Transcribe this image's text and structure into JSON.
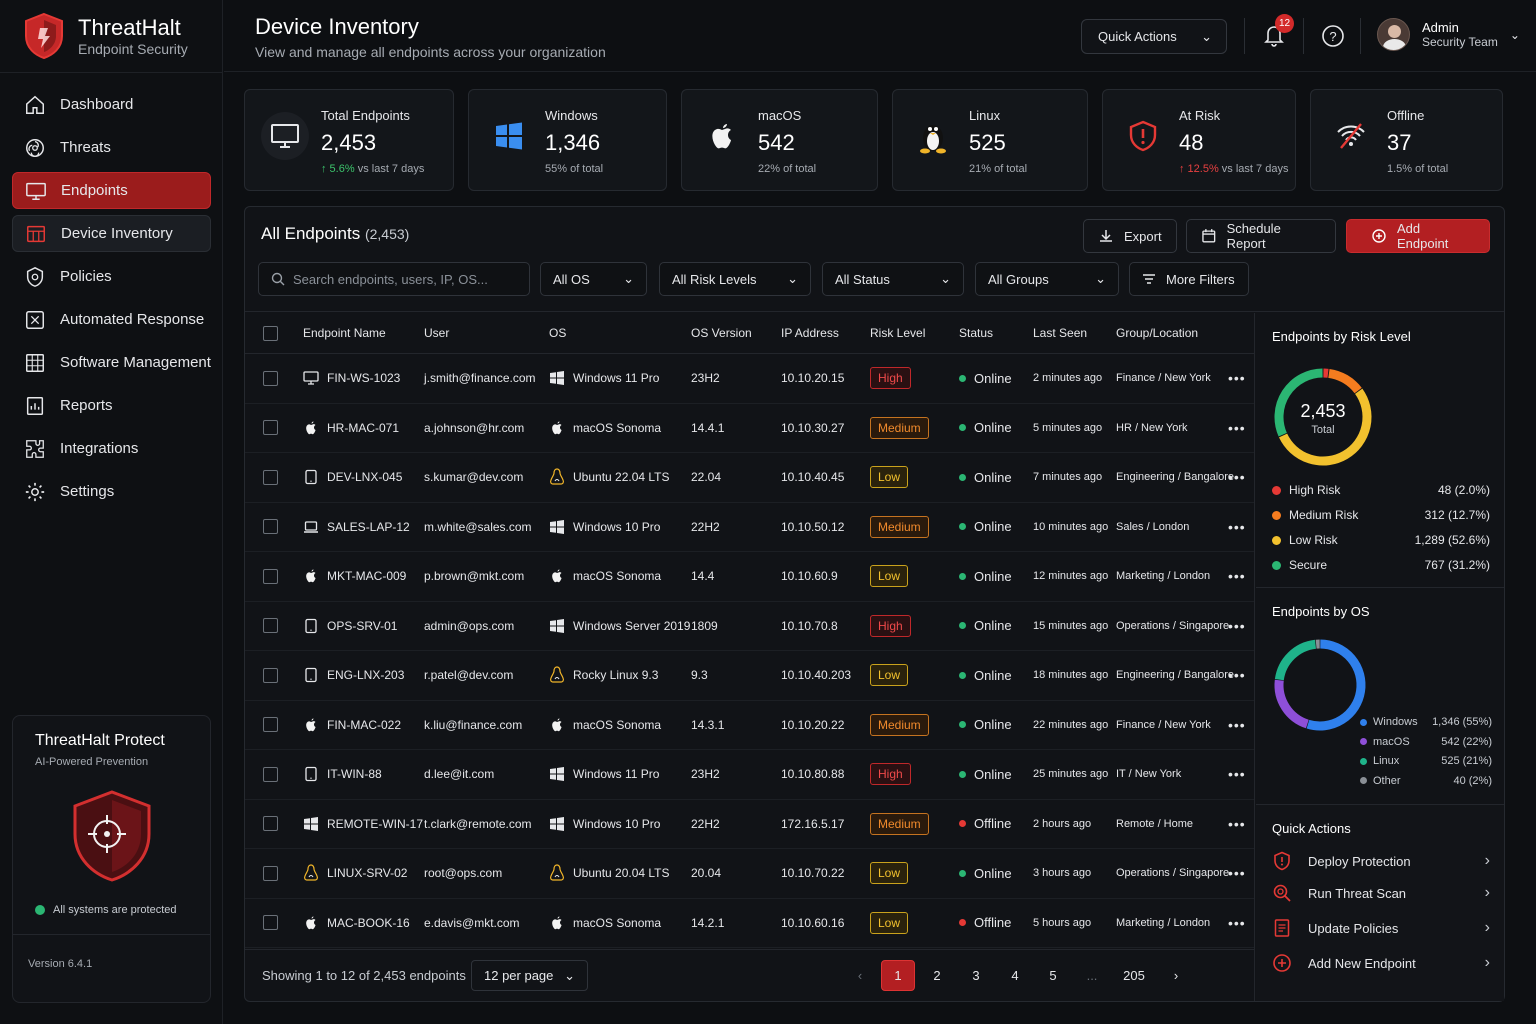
{
  "brand": {
    "name": "ThreatHalt",
    "tagline": "Endpoint Security"
  },
  "nav": [
    {
      "label": "Dashboard",
      "icon": "home-icon",
      "state": "normal"
    },
    {
      "label": "Threats",
      "icon": "biohazard-icon",
      "state": "normal"
    },
    {
      "label": "Endpoints",
      "icon": "monitor-icon",
      "state": "active"
    },
    {
      "label": "Device Inventory",
      "icon": "inventory-icon",
      "state": "sub"
    },
    {
      "label": "Policies",
      "icon": "policy-icon",
      "state": "normal"
    },
    {
      "label": "Automated Response",
      "icon": "automation-icon",
      "state": "normal"
    },
    {
      "label": "Software Management",
      "icon": "grid-icon",
      "state": "normal"
    },
    {
      "label": "Reports",
      "icon": "report-icon",
      "state": "normal"
    },
    {
      "label": "Integrations",
      "icon": "puzzle-icon",
      "state": "normal"
    },
    {
      "label": "Settings",
      "icon": "gear-icon",
      "state": "normal"
    }
  ],
  "promo": {
    "title": "ThreatHalt Protect",
    "subtitle": "AI-Powered Prevention",
    "status": "All systems are protected",
    "version": "Version 6.4.1"
  },
  "header": {
    "title": "Device Inventory",
    "subtitle": "View and manage all endpoints across your organization",
    "quick_actions": "Quick Actions",
    "notifications": "12",
    "user_name": "Admin",
    "user_role": "Security Team"
  },
  "stats": [
    {
      "label": "Total Endpoints",
      "value": "2,453",
      "trend": "↑ 5.6%",
      "note": " vs last 7 days",
      "icon": "monitor-icon",
      "trend_color": "green"
    },
    {
      "label": "Windows",
      "value": "1,346",
      "trend": "",
      "note": "55% of total",
      "icon": "windows-icon"
    },
    {
      "label": "macOS",
      "value": "542",
      "trend": "",
      "note": "22% of total",
      "icon": "apple-icon"
    },
    {
      "label": "Linux",
      "value": "525",
      "trend": "",
      "note": "21% of total",
      "icon": "linux-icon"
    },
    {
      "label": "At Risk",
      "value": "48",
      "trend": "↑ 12.5%",
      "note": " vs last 7 days",
      "icon": "shield-alert-icon",
      "trend_color": "red"
    },
    {
      "label": "Offline",
      "value": "37",
      "trend": "",
      "note": "1.5% of total",
      "icon": "wifi-off-icon"
    }
  ],
  "panel": {
    "title": "All Endpoints",
    "count": "(2,453)",
    "export": "Export",
    "schedule": "Schedule Report",
    "add": "Add Endpoint",
    "search_placeholder": "Search endpoints, users, IP, OS...",
    "filters": [
      "All OS",
      "All Risk Levels",
      "All Status",
      "All Groups"
    ],
    "more_filters": "More Filters"
  },
  "table": {
    "headers": [
      "Endpoint Name",
      "User",
      "OS",
      "OS Version",
      "IP Address",
      "Risk Level",
      "Status",
      "Last Seen",
      "Group/Location"
    ],
    "rows": [
      {
        "name": "FIN-WS-1023",
        "device": "desktop",
        "user": "j.smith@finance.com",
        "os": "Windows 11 Pro",
        "os_icon": "windows",
        "ver": "23H2",
        "ip": "10.10.20.15",
        "risk": "High",
        "status": "Online",
        "seen": "2 minutes ago",
        "group": "Finance / New York"
      },
      {
        "name": "HR-MAC-071",
        "device": "apple",
        "user": "a.johnson@hr.com",
        "os": "macOS Sonoma",
        "os_icon": "apple",
        "ver": "14.4.1",
        "ip": "10.10.30.27",
        "risk": "Medium",
        "status": "Online",
        "seen": "5 minutes ago",
        "group": "HR / New York"
      },
      {
        "name": "DEV-LNX-045",
        "device": "tablet",
        "user": "s.kumar@dev.com",
        "os": "Ubuntu 22.04 LTS",
        "os_icon": "linux",
        "ver": "22.04",
        "ip": "10.10.40.45",
        "risk": "Low",
        "status": "Online",
        "seen": "7 minutes ago",
        "group": "Engineering / Bangalore"
      },
      {
        "name": "SALES-LAP-12",
        "device": "laptop",
        "user": "m.white@sales.com",
        "os": "Windows 10 Pro",
        "os_icon": "windows",
        "ver": "22H2",
        "ip": "10.10.50.12",
        "risk": "Medium",
        "status": "Online",
        "seen": "10 minutes ago",
        "group": "Sales / London"
      },
      {
        "name": "MKT-MAC-009",
        "device": "apple",
        "user": "p.brown@mkt.com",
        "os": "macOS Sonoma",
        "os_icon": "apple",
        "ver": "14.4",
        "ip": "10.10.60.9",
        "risk": "Low",
        "status": "Online",
        "seen": "12 minutes ago",
        "group": "Marketing / London"
      },
      {
        "name": "OPS-SRV-01",
        "device": "tablet",
        "user": "admin@ops.com",
        "os": "Windows Server 2019",
        "os_icon": "windows",
        "ver": "1809",
        "ip": "10.10.70.8",
        "risk": "High",
        "status": "Online",
        "seen": "15 minutes ago",
        "group": "Operations / Singapore"
      },
      {
        "name": "ENG-LNX-203",
        "device": "tablet",
        "user": "r.patel@dev.com",
        "os": "Rocky Linux 9.3",
        "os_icon": "linux",
        "ver": "9.3",
        "ip": "10.10.40.203",
        "risk": "Low",
        "status": "Online",
        "seen": "18 minutes ago",
        "group": "Engineering / Bangalore"
      },
      {
        "name": "FIN-MAC-022",
        "device": "apple",
        "user": "k.liu@finance.com",
        "os": "macOS Sonoma",
        "os_icon": "apple",
        "ver": "14.3.1",
        "ip": "10.10.20.22",
        "risk": "Medium",
        "status": "Online",
        "seen": "22 minutes ago",
        "group": "Finance / New York"
      },
      {
        "name": "IT-WIN-88",
        "device": "tablet",
        "user": "d.lee@it.com",
        "os": "Windows 11 Pro",
        "os_icon": "windows",
        "ver": "23H2",
        "ip": "10.10.80.88",
        "risk": "High",
        "status": "Online",
        "seen": "25 minutes ago",
        "group": "IT / New York"
      },
      {
        "name": "REMOTE-WIN-17",
        "device": "windows",
        "user": "t.clark@remote.com",
        "os": "Windows 10 Pro",
        "os_icon": "windows",
        "ver": "22H2",
        "ip": "172.16.5.17",
        "risk": "Medium",
        "status": "Offline",
        "seen": "2 hours ago",
        "group": "Remote / Home"
      },
      {
        "name": "LINUX-SRV-02",
        "device": "linux",
        "user": "root@ops.com",
        "os": "Ubuntu 20.04 LTS",
        "os_icon": "linux",
        "ver": "20.04",
        "ip": "10.10.70.22",
        "risk": "Low",
        "status": "Online",
        "seen": "3 hours ago",
        "group": "Operations / Singapore"
      },
      {
        "name": "MAC-BOOK-16",
        "device": "apple",
        "user": "e.davis@mkt.com",
        "os": "macOS Sonoma",
        "os_icon": "apple",
        "ver": "14.2.1",
        "ip": "10.10.60.16",
        "risk": "Low",
        "status": "Offline",
        "seen": "5 hours ago",
        "group": "Marketing / London"
      }
    ]
  },
  "pagination": {
    "showing": "Showing 1 to 12 of 2,453 endpoints",
    "per_page": "12 per page",
    "pages": [
      "1",
      "2",
      "3",
      "4",
      "5",
      "...",
      "205"
    ],
    "current": "1"
  },
  "risk_chart": {
    "title": "Endpoints by Risk Level",
    "center_value": "2,453",
    "center_label": "Total",
    "items": [
      {
        "label": "High Risk",
        "value": 48,
        "display": "48 (2.0%)",
        "color": "#e53935"
      },
      {
        "label": "Medium Risk",
        "value": 312,
        "display": "312 (12.7%)",
        "color": "#f57c1f"
      },
      {
        "label": "Low Risk",
        "value": 1289,
        "display": "1,289 (52.6%)",
        "color": "#f2c12e"
      },
      {
        "label": "Secure",
        "value": 767,
        "display": "767 (31.2%)",
        "color": "#2bb673"
      }
    ]
  },
  "os_chart": {
    "title": "Endpoints by OS",
    "items": [
      {
        "label": "Windows",
        "value": 1346,
        "display": "1,346 (55%)",
        "color": "#2f80ed"
      },
      {
        "label": "macOS",
        "value": 542,
        "display": "542 (22%)",
        "color": "#8e4fd8"
      },
      {
        "label": "Linux",
        "value": 525,
        "display": "525 (21%)",
        "color": "#1fb38a"
      },
      {
        "label": "Other",
        "value": 40,
        "display": "40 (2%)",
        "color": "#8a8f96"
      }
    ]
  },
  "quick_actions": {
    "title": "Quick Actions",
    "items": [
      {
        "label": "Deploy Protection",
        "icon": "shield-icon"
      },
      {
        "label": "Run Threat Scan",
        "icon": "scan-icon"
      },
      {
        "label": "Update Policies",
        "icon": "document-icon"
      },
      {
        "label": "Add New Endpoint",
        "icon": "plus-circle-icon"
      }
    ]
  },
  "colors": {
    "accent": "#b31f22",
    "green": "#3cc36b",
    "red": "#e74040"
  }
}
